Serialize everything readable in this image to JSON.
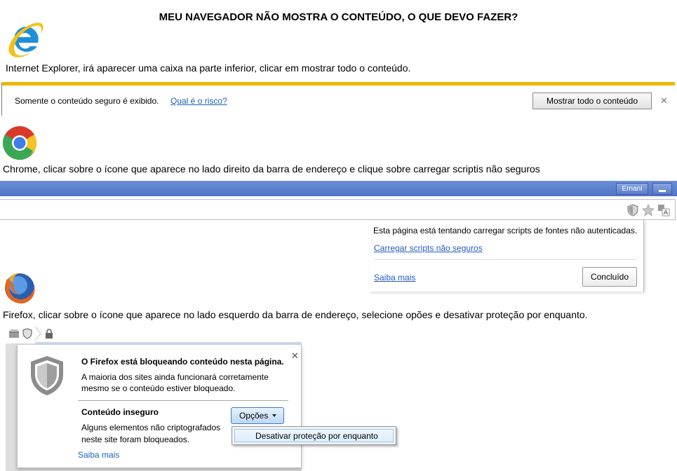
{
  "page": {
    "title": "MEU NAVEGADOR NÃO MOSTRA O CONTEÚDO, O QUE DEVO FAZER?"
  },
  "ie": {
    "instruction": "Internet Explorer, irá aparecer uma caixa na parte inferior, clicar em mostrar todo o conteúdo.",
    "notification_text": "Somente o conteúdo seguro é exibido.",
    "risk_link": "Qual é o risco?",
    "show_all_button": "Mostrar todo o conteúdo",
    "close_symbol": "✕",
    "accent_color": "#f0b400"
  },
  "chrome": {
    "instruction": "Chrome, clicar sobre o ícone que aparece no lado direito da barra de endereço e clique sobre carregar scriptis não seguros",
    "profile_name": "Ernani",
    "popup_message": "Esta página está tentando carregar scripts de fontes não autenticadas.",
    "load_unsafe_link": "Carregar scripts não seguros",
    "learn_more_link": "Saiba mais",
    "done_button": "Concluído",
    "frame_color": "#5b7dcb"
  },
  "firefox": {
    "instruction": "Firefox, clicar sobre o ícone que aparece no lado esquerdo da barra de endereço, selecione opões e desativar proteção por enquanto.",
    "panel_heading": "O Firefox está bloqueando conteúdo nesta página.",
    "panel_text": "A maioria dos sites ainda funcionará corretamente mesmo se o conteúdo estiver bloqueado.",
    "section_heading": "Conteúdo inseguro",
    "section_text": "Alguns elementos não criptografados neste site foram bloqueados.",
    "options_button": "Opções",
    "disable_protection_item": "Desativar proteção por enquanto",
    "learn_more_link": "Saiba mais",
    "close_symbol": "✕"
  }
}
